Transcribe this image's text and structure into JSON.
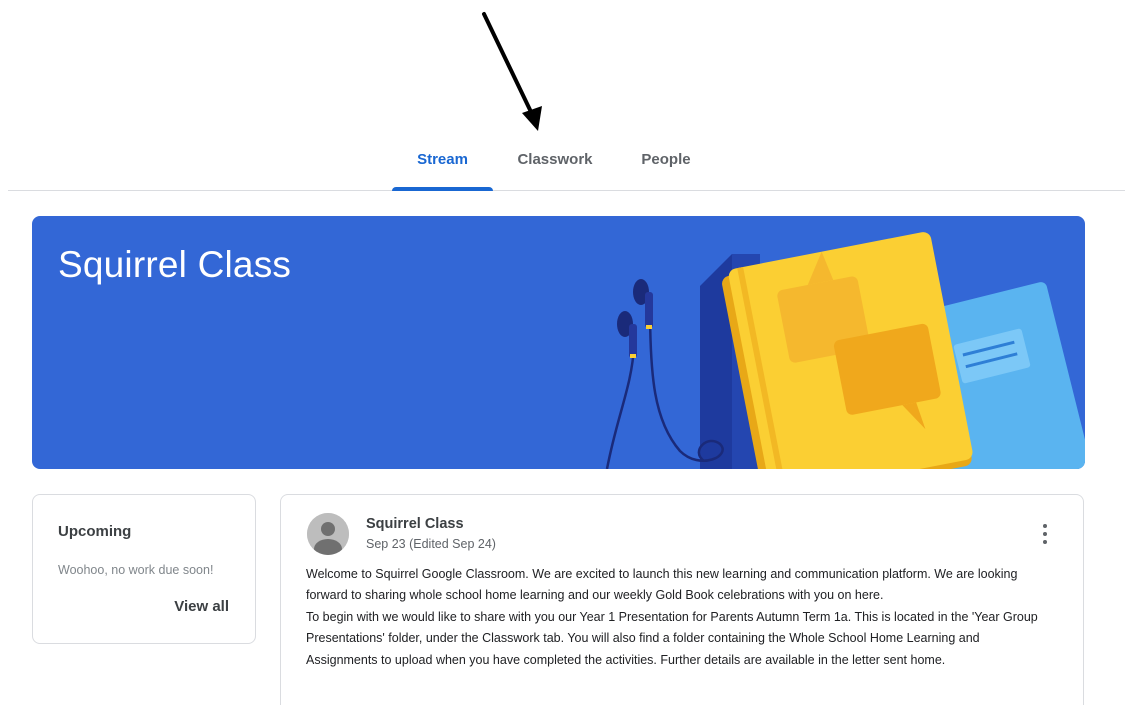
{
  "tabs": [
    {
      "label": "Stream",
      "active": true
    },
    {
      "label": "Classwork",
      "active": false
    },
    {
      "label": "People",
      "active": false
    }
  ],
  "banner": {
    "title": "Squirrel Class",
    "background": "#3367d6"
  },
  "upcoming": {
    "title": "Upcoming",
    "message": "Woohoo, no work due soon!",
    "view_all_label": "View all"
  },
  "post": {
    "author": "Squirrel Class",
    "date": "Sep 23 (Edited Sep 24)",
    "avatar_icon": "person-avatar-icon",
    "menu_icon": "more-vert-icon",
    "paragraphs": [
      "Welcome to Squirrel Google Classroom. We are excited to launch this new learning and communication platform. We are looking forward to sharing whole school home learning and our weekly Gold Book celebrations with you on here.",
      "To begin with we would like to share with you our Year 1 Presentation for Parents Autumn Term 1a. This is located in the 'Year Group Presentations' folder, under the Classwork tab. You will also find a folder containing the Whole School Home Learning and Assignments to upload when you have completed the activities. Further details are available in the letter sent home."
    ]
  },
  "colors": {
    "accent": "#1967d2",
    "banner": "#3367d6",
    "book_yellow": "#fbcf33",
    "book_blue": "#5ab4f0"
  }
}
